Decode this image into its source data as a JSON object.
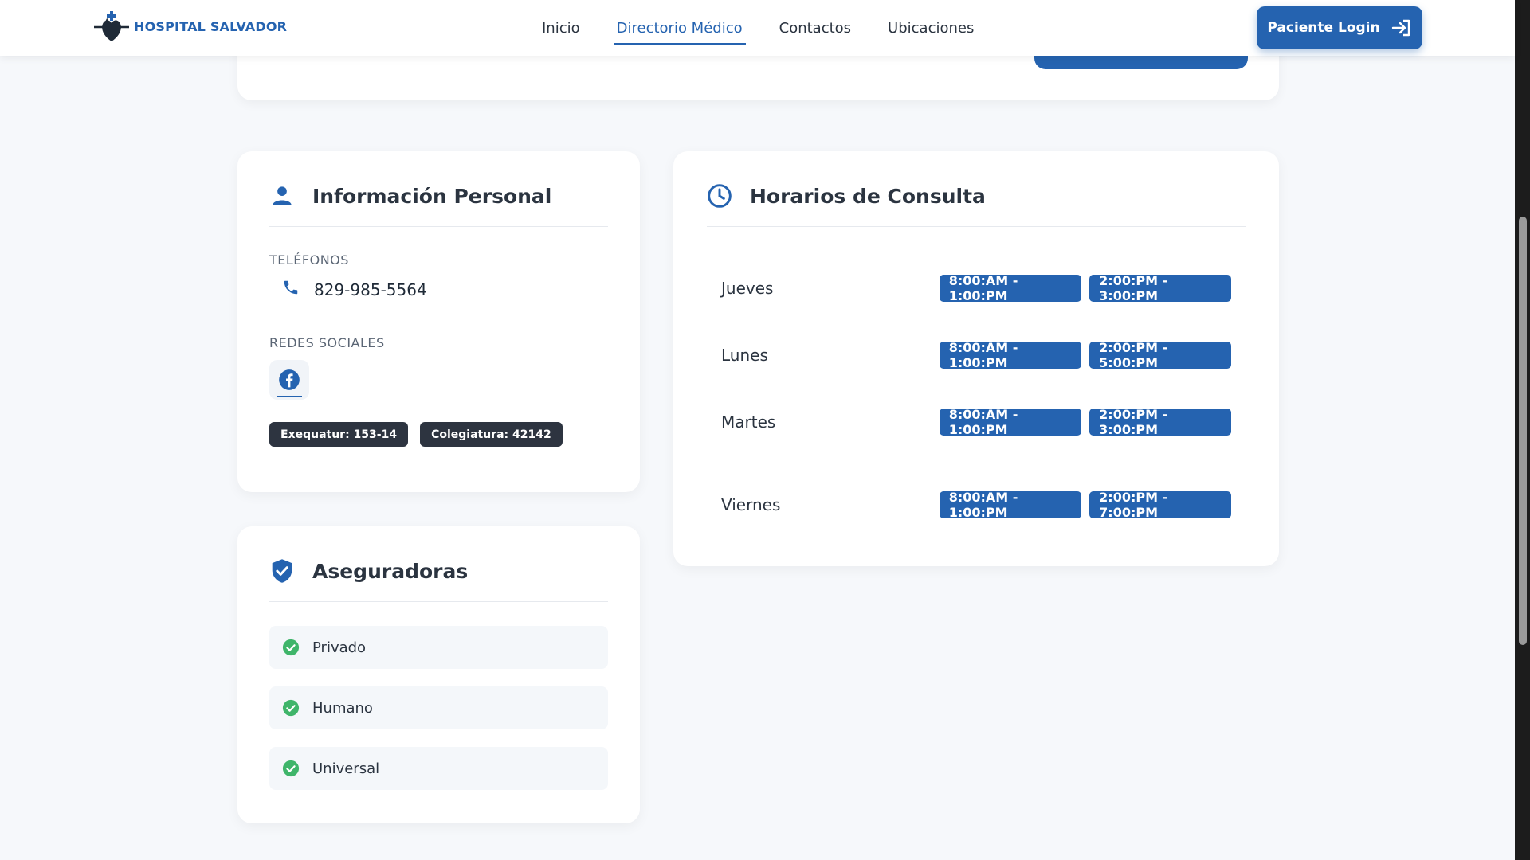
{
  "brand": {
    "name": "HOSPITAL SALVADOR",
    "color": "#2563b0"
  },
  "nav": {
    "items": [
      {
        "label": "Inicio",
        "active": false
      },
      {
        "label": "Directorio Médico",
        "active": true
      },
      {
        "label": "Contactos",
        "active": false
      },
      {
        "label": "Ubicaciones",
        "active": false
      }
    ],
    "login_label": "Paciente Login"
  },
  "personal": {
    "title": "Información Personal",
    "phones_label": "TELÉFONOS",
    "phone": "829-985-5564",
    "social_label": "REDES SOCIALES",
    "social": [
      "facebook-icon"
    ],
    "badges": [
      "Exequatur: 153-14",
      "Colegiatura: 42142"
    ]
  },
  "insurers": {
    "title": "Aseguradoras",
    "items": [
      "Privado",
      "Humano",
      "Universal"
    ]
  },
  "schedule": {
    "title": "Horarios de Consulta",
    "rows": [
      {
        "day": "Jueves",
        "slots": [
          "8:00:AM - 1:00:PM",
          "2:00:PM - 3:00:PM"
        ]
      },
      {
        "day": "Lunes",
        "slots": [
          "8:00:AM - 1:00:PM",
          "2:00:PM - 5:00:PM"
        ]
      },
      {
        "day": "Martes",
        "slots": [
          "8:00:AM - 1:00:PM",
          "2:00:PM - 3:00:PM"
        ]
      },
      {
        "day": "Viernes",
        "slots": [
          "8:00:AM - 1:00:PM",
          "2:00:PM - 7:00:PM"
        ]
      }
    ]
  }
}
